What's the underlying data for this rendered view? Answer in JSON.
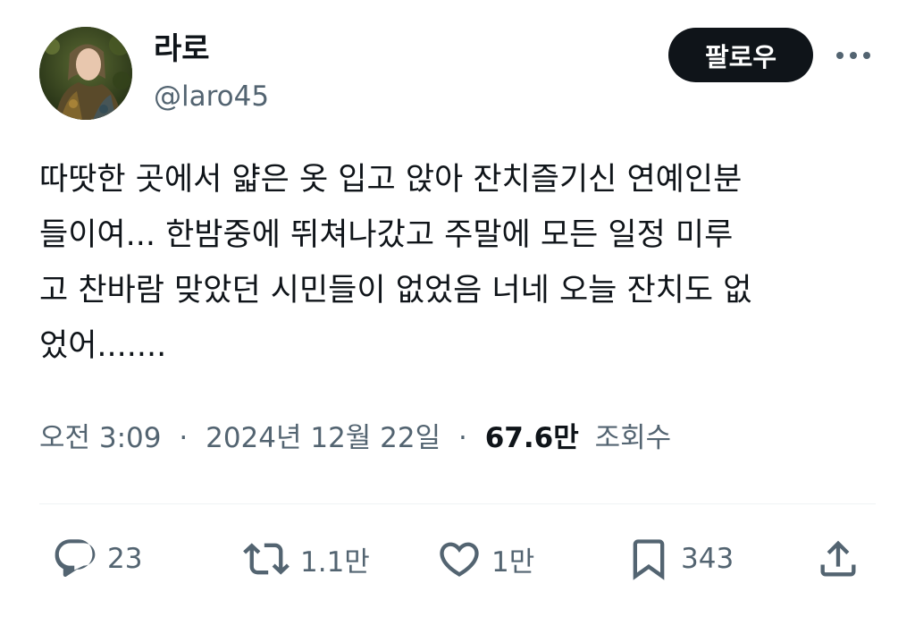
{
  "author": {
    "display_name": "라로",
    "handle": "@laro45"
  },
  "header": {
    "follow_label": "팔로우"
  },
  "tweet": {
    "lines": [
      "따땃한 곳에서 얇은 옷 입고 앉아 잔치즐기신 연예인분",
      "들이여... 한밤중에 뛰쳐나갔고 주말에 모든 일정 미루",
      "고 찬바람 맞았던 시민들이 없었음 너네 오늘 잔치도 없",
      "었어......."
    ]
  },
  "meta": {
    "time": "오전 3:09",
    "date": "2024년 12월 22일",
    "separator": "·",
    "views_count": "67.6만",
    "views_label": "조회수"
  },
  "actions": {
    "replies": "23",
    "reposts": "1.1만",
    "likes": "1만",
    "bookmarks": "343"
  },
  "colors": {
    "text": "#0f1419",
    "secondary": "#536471",
    "follow_bg": "#0f1419",
    "divider": "#eff3f4"
  },
  "icons": {
    "more": "more-horizontal-icon",
    "reply": "reply-icon",
    "repost": "repost-icon",
    "like": "heart-icon",
    "bookmark": "bookmark-icon",
    "share": "share-icon"
  }
}
